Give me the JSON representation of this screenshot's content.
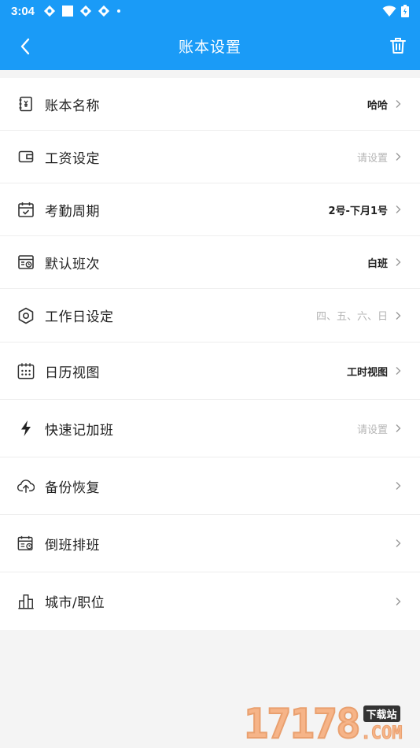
{
  "status": {
    "time": "3:04"
  },
  "nav": {
    "title": "账本设置"
  },
  "rows": [
    {
      "label": "账本名称",
      "value": "哈哈",
      "muted": false,
      "icon": "ledger-icon"
    },
    {
      "label": "工资设定",
      "value": "请设置",
      "muted": true,
      "icon": "wallet-icon"
    },
    {
      "label": "考勤周期",
      "value": "2号-下月1号",
      "muted": false,
      "icon": "calendar-check-icon"
    },
    {
      "label": "默认班次",
      "value": "白班",
      "muted": false,
      "icon": "shift-icon"
    },
    {
      "label": "工作日设定",
      "value": "四、五、六、日",
      "muted": true,
      "icon": "hexagon-settings-icon"
    },
    {
      "label": "日历视图",
      "value": "工时视图",
      "muted": false,
      "icon": "calendar-grid-icon"
    },
    {
      "label": "快速记加班",
      "value": "请设置",
      "muted": true,
      "icon": "lightning-icon"
    },
    {
      "label": "备份恢复",
      "value": "",
      "muted": false,
      "icon": "cloud-upload-icon"
    },
    {
      "label": "倒班排班",
      "value": "",
      "muted": false,
      "icon": "schedule-icon"
    },
    {
      "label": "城市/职位",
      "value": "",
      "muted": false,
      "icon": "city-icon"
    }
  ],
  "watermark": {
    "number": "17178",
    "site": "下载站",
    "domain": ".COM"
  },
  "colors": {
    "primary": "#1a9bf7",
    "muted": "#b5b5b5"
  }
}
